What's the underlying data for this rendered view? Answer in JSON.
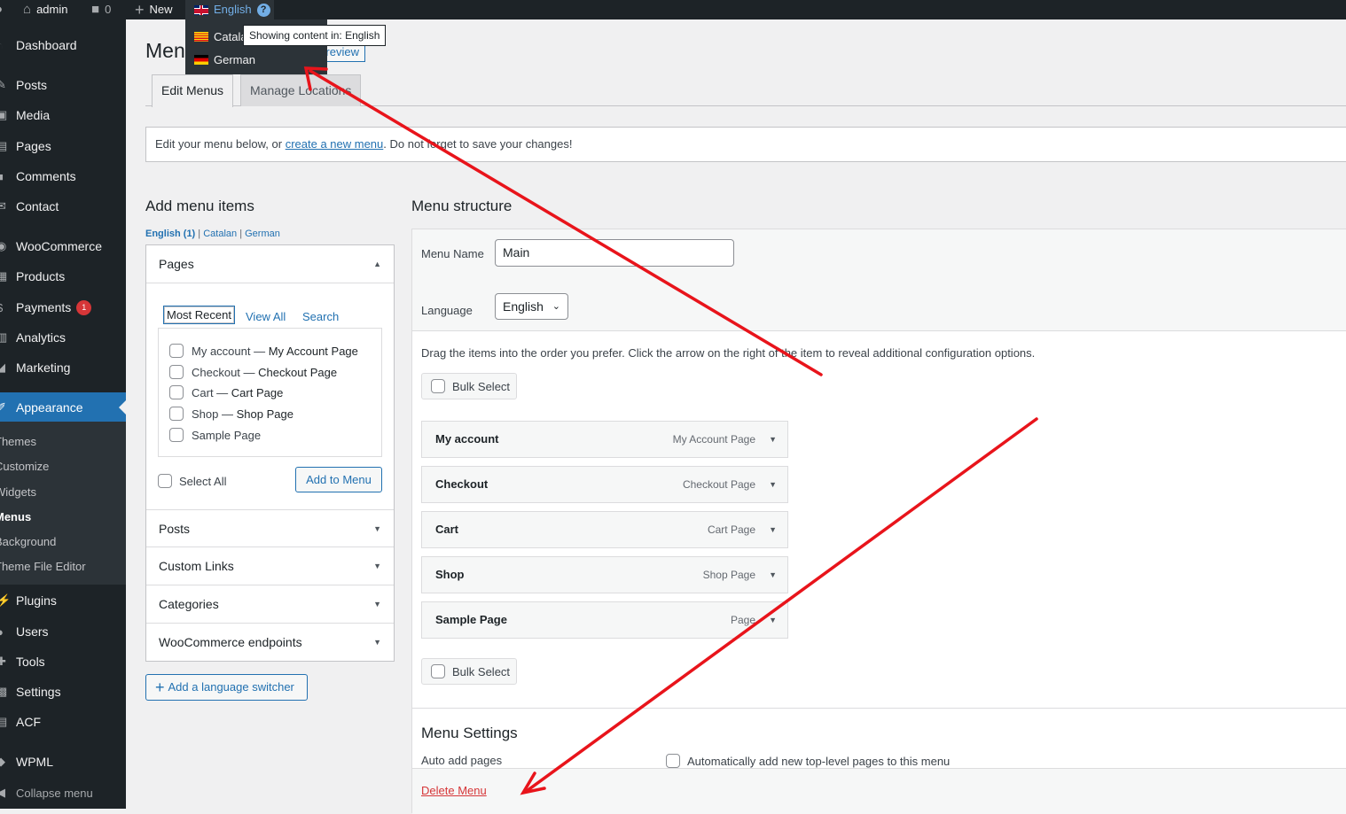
{
  "admin_bar": {
    "site": "admin",
    "comments_count": "0",
    "new_label": "New",
    "language": "English",
    "help": "?"
  },
  "lang_dropdown": {
    "items": [
      "Catalan",
      "German"
    ],
    "tooltip": "Showing content in: English"
  },
  "sidebar": {
    "items": [
      "Dashboard",
      "Posts",
      "Media",
      "Pages",
      "Comments",
      "Contact",
      "WooCommerce",
      "Products",
      "Payments",
      "Analytics",
      "Marketing",
      "Appearance",
      "Plugins",
      "Users",
      "Tools",
      "Settings",
      "ACF",
      "WPML",
      "Collapse menu"
    ],
    "payments_badge": "1",
    "submenu": [
      "Themes",
      "Customize",
      "Widgets",
      "Menus",
      "Background",
      "Theme File Editor"
    ]
  },
  "page": {
    "title": "Menus",
    "preview_label": "Live Preview",
    "tabs": [
      "Edit Menus",
      "Manage Locations"
    ],
    "notice_before": "Edit your menu below, or ",
    "notice_link": "create a new menu",
    "notice_after": ". Do not forget to save your changes!"
  },
  "add_items": {
    "title": "Add menu items",
    "lang_links": [
      "English (1)",
      "Catalan",
      "German"
    ],
    "sections": [
      "Pages",
      "Posts",
      "Custom Links",
      "Categories",
      "WooCommerce endpoints"
    ],
    "sub_tabs": [
      "Most Recent",
      "View All",
      "Search"
    ],
    "pages": [
      {
        "label": "My account",
        "sep": " — ",
        "post": "My Account Page"
      },
      {
        "label": "Checkout",
        "sep": " — ",
        "post": "Checkout Page"
      },
      {
        "label": "Cart",
        "sep": " — ",
        "post": "Cart Page"
      },
      {
        "label": "Shop",
        "sep": " — ",
        "post": "Shop Page"
      },
      {
        "label": "Sample Page",
        "sep": "",
        "post": ""
      }
    ],
    "select_all": "Select All",
    "add_button": "Add to Menu",
    "lang_switcher_button": "Add a language switcher"
  },
  "structure": {
    "title": "Menu structure",
    "menu_name_label": "Menu Name",
    "menu_name_value": "Main",
    "language_label": "Language",
    "language_value": "English",
    "instructions": "Drag the items into the order you prefer. Click the arrow on the right of the item to reveal additional configuration options.",
    "bulk_select": "Bulk Select",
    "items": [
      {
        "title": "My account",
        "type": "My Account Page"
      },
      {
        "title": "Checkout",
        "type": "Checkout Page"
      },
      {
        "title": "Cart",
        "type": "Cart Page"
      },
      {
        "title": "Shop",
        "type": "Shop Page"
      },
      {
        "title": "Sample Page",
        "type": "Page"
      }
    ],
    "settings_title": "Menu Settings",
    "auto_add_label": "Auto add pages",
    "auto_add_option": "Automatically add new top-level pages to this menu",
    "delete_label": "Delete Menu"
  },
  "colors": {
    "accent": "#2271b1",
    "annotation": "#e8141b",
    "danger": "#d63638",
    "sidebar_bg": "#1d2327"
  }
}
